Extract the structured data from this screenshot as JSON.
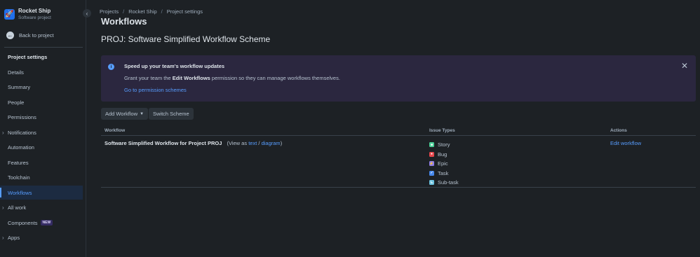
{
  "project": {
    "name": "Rocket Ship",
    "type": "Software project",
    "avatar_icon": "rocket-icon"
  },
  "sidebar": {
    "back_label": "Back to project",
    "section_title": "Project settings",
    "items": [
      {
        "label": "Details",
        "expandable": false
      },
      {
        "label": "Summary",
        "expandable": false
      },
      {
        "label": "People",
        "expandable": false
      },
      {
        "label": "Permissions",
        "expandable": false
      },
      {
        "label": "Notifications",
        "expandable": true
      },
      {
        "label": "Automation",
        "expandable": false
      },
      {
        "label": "Features",
        "expandable": false
      },
      {
        "label": "Toolchain",
        "expandable": false
      },
      {
        "label": "Workflows",
        "expandable": false,
        "active": true
      },
      {
        "label": "All work",
        "expandable": true
      },
      {
        "label": "Components",
        "expandable": false,
        "badge": "NEW"
      },
      {
        "label": "Apps",
        "expandable": true
      }
    ]
  },
  "breadcrumb": [
    "Projects",
    "Rocket Ship",
    "Project settings"
  ],
  "page_title": "Workflows",
  "scheme_title": "PROJ: Software Simplified Workflow Scheme",
  "banner": {
    "title": "Speed up your team's workflow updates",
    "text_before": "Grant your team the",
    "text_bold": "Edit Workflows",
    "text_after": "permission so they can manage workflows themselves.",
    "link": "Go to permission schemes",
    "colors": {
      "background": "#2b273f",
      "info": "#579dff"
    }
  },
  "toolbar": {
    "add_workflow": "Add Workflow",
    "switch_scheme": "Switch Scheme"
  },
  "table": {
    "headers": {
      "workflow": "Workflow",
      "issue_types": "Issue Types",
      "actions": "Actions"
    },
    "rows": [
      {
        "workflow_name": "Software Simplified Workflow for Project PROJ",
        "view_prefix": "(View as",
        "view_text": "text",
        "view_sep": "/",
        "view_diagram": "diagram",
        "view_suffix": ")",
        "issue_types": [
          {
            "name": "Story",
            "color": "#4bce97",
            "icon": "story-icon"
          },
          {
            "name": "Bug",
            "color": "#e5484d",
            "icon": "bug-icon"
          },
          {
            "name": "Epic",
            "color": "#8f7ee7",
            "icon": "epic-icon"
          },
          {
            "name": "Task",
            "color": "#4688ec",
            "icon": "task-icon"
          },
          {
            "name": "Sub-task",
            "color": "#6cc3e0",
            "icon": "subtask-icon"
          }
        ],
        "action": "Edit workflow"
      }
    ]
  }
}
